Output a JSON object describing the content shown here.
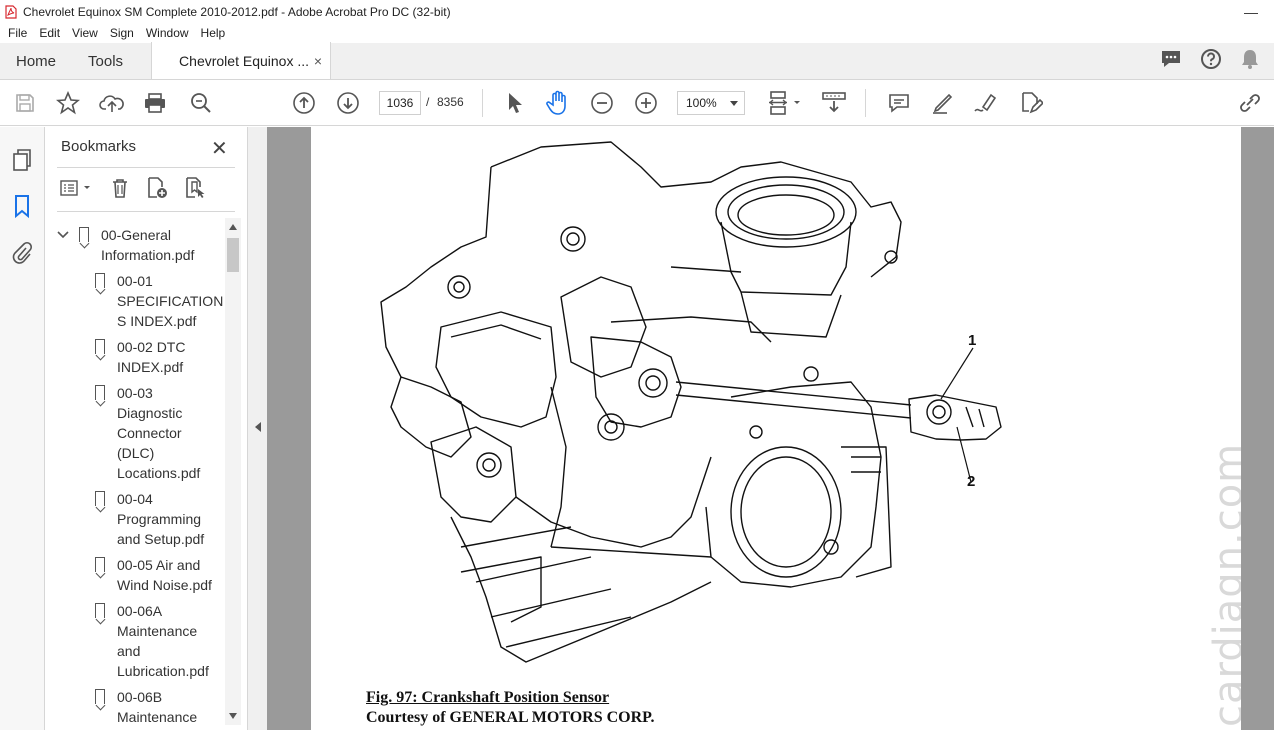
{
  "window": {
    "title": "Chevrolet Equinox SM Complete 2010-2012.pdf - Adobe Acrobat Pro DC (32-bit)",
    "minimize": "—"
  },
  "menu": [
    "File",
    "Edit",
    "View",
    "Sign",
    "Window",
    "Help"
  ],
  "tabs": {
    "home": "Home",
    "tools": "Tools",
    "document": "Chevrolet Equinox ...",
    "close": "×"
  },
  "toolbar": {
    "current_page": "1036",
    "page_separator": "/",
    "total_pages": "8356",
    "zoom": "100%"
  },
  "bookmarks": {
    "header": "Bookmarks",
    "close": "✕",
    "items": [
      {
        "lines": [
          "00-General",
          "Information.pdf"
        ],
        "level": 0,
        "expanded": true
      },
      {
        "lines": [
          "00-01",
          "SPECIFICATION",
          "S INDEX.pdf"
        ],
        "level": 1
      },
      {
        "lines": [
          "00-02 DTC",
          "INDEX.pdf"
        ],
        "level": 1
      },
      {
        "lines": [
          "00-03",
          "Diagnostic",
          "Connector",
          "(DLC)",
          "Locations.pdf"
        ],
        "level": 1
      },
      {
        "lines": [
          "00-04",
          "Programming",
          "and Setup.pdf"
        ],
        "level": 1
      },
      {
        "lines": [
          "00-05 Air and",
          "Wind Noise.pdf"
        ],
        "level": 1
      },
      {
        "lines": [
          "00-06A",
          "Maintenance",
          "and",
          "Lubrication.pdf"
        ],
        "level": 1
      },
      {
        "lines": [
          "00-06B",
          "Maintenance"
        ],
        "level": 1
      }
    ]
  },
  "document": {
    "figure_title": "Fig. 97: Crankshaft Position Sensor",
    "courtesy": "Courtesy of GENERAL MOTORS CORP.",
    "callout_1": "1",
    "callout_2": "2",
    "watermark": "cardiagn.com"
  }
}
